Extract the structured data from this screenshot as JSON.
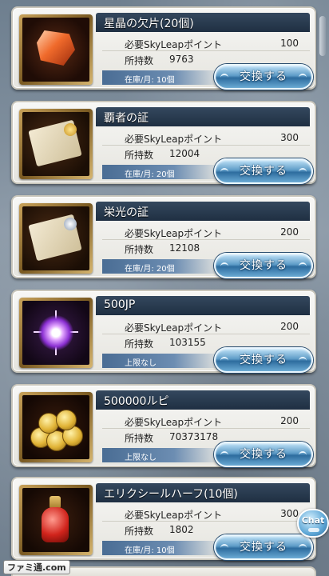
{
  "labels": {
    "required_points": "必要SkyLeapポイント",
    "owned": "所持数",
    "exchange": "交換する"
  },
  "items": [
    {
      "name": "星晶の欠片(20個)",
      "cost": "100",
      "owned": "9763",
      "stock": "在庫/月: 10個",
      "icon": "crystal-fragment-icon"
    },
    {
      "name": "覇者の証",
      "cost": "300",
      "owned": "12004",
      "stock": "在庫/月: 20個",
      "icon": "champion-proof-icon"
    },
    {
      "name": "栄光の証",
      "cost": "200",
      "owned": "12108",
      "stock": "在庫/月: 20個",
      "icon": "glory-proof-icon"
    },
    {
      "name": "500JP",
      "cost": "200",
      "owned": "103155",
      "stock": "上限なし",
      "icon": "jp-orb-icon"
    },
    {
      "name": "500000ルピ",
      "cost": "200",
      "owned": "70373178",
      "stock": "上限なし",
      "icon": "rupie-coins-icon"
    },
    {
      "name": "エリクシールハーフ(10個)",
      "cost": "300",
      "owned": "1802",
      "stock": "在庫/月: 10個",
      "icon": "elixir-half-icon"
    }
  ],
  "chat": {
    "label": "Chat"
  },
  "watermark": {
    "text": "ファミ通.com"
  },
  "colors": {
    "title_bar": "#1f2f42",
    "button": "#2d6c9e",
    "stock_bar": "#4a6d94"
  }
}
